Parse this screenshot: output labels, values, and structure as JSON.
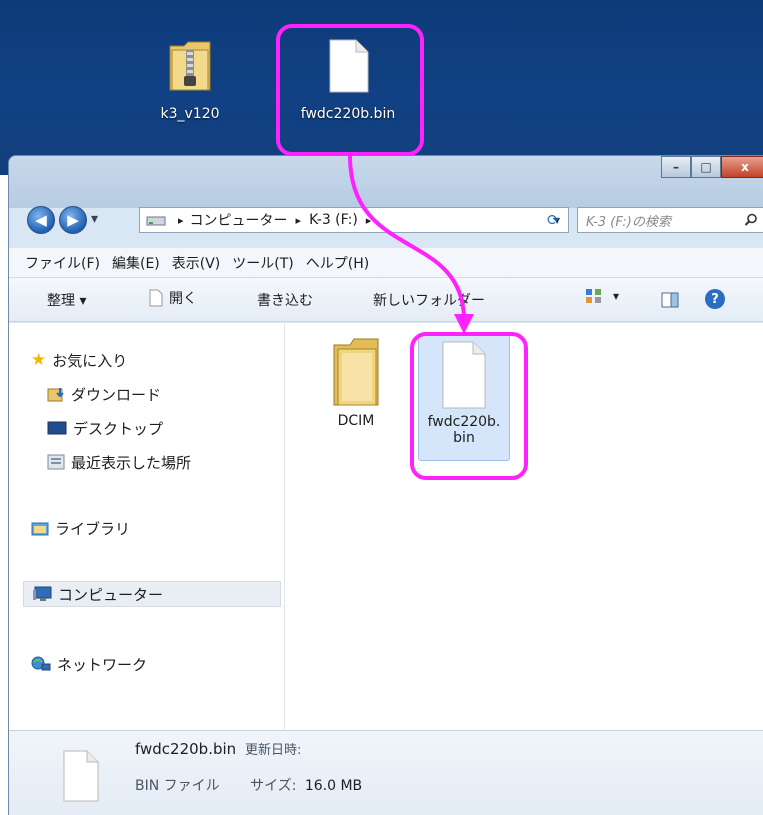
{
  "desktop": {
    "icons": [
      {
        "name": "zip-folder-icon",
        "label": "k3_v120"
      },
      {
        "name": "file-icon",
        "label": "fwdc220b.bin"
      }
    ]
  },
  "window": {
    "buttons": {
      "minimize": "–",
      "maximize": "□",
      "close": "x"
    },
    "nav": {
      "back": "◀",
      "forward": "▶",
      "history": "▾"
    },
    "address": {
      "sep": "▸",
      "crumbs": [
        "コンピューター",
        "K-3 (F:)"
      ],
      "dropdown": "▾",
      "refresh": "⟳"
    },
    "search": {
      "placeholder": "K-3 (F:)の検索",
      "icon": "search-icon"
    },
    "menu": [
      "ファイル(F)",
      "編集(E)",
      "表示(V)",
      "ツール(T)",
      "ヘルプ(H)"
    ],
    "toolbar": {
      "organize": "整理 ▾",
      "open": "開く",
      "burn": "書き込む",
      "new_folder": "新しいフォルダー",
      "view_arrow": "▾",
      "help": "?"
    },
    "nav_pane": {
      "favorites": "お気に入り",
      "downloads": "ダウンロード",
      "desktop": "デスクトップ",
      "recent": "最近表示した場所",
      "libraries": "ライブラリ",
      "computer": "コンピューター",
      "network": "ネットワーク"
    },
    "files": [
      {
        "name": "DCIM",
        "type": "folder"
      },
      {
        "name_line1": "fwdc220b.",
        "name_line2": "bin",
        "type": "file"
      }
    ],
    "details": {
      "filename": "fwdc220b.bin",
      "modified_label": "更新日時:",
      "type": "BIN ファイル",
      "size_label": "サイズ:",
      "size_value": "16.0 MB"
    }
  },
  "colors": {
    "accent_highlight": "#ff22ff",
    "desktop": "#114184",
    "selection": "#d5e6fa"
  }
}
